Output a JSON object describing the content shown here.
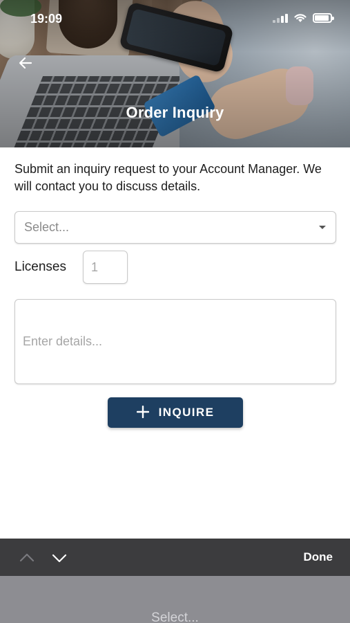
{
  "status_bar": {
    "time": "19:09"
  },
  "header": {
    "title": "Order Inquiry",
    "back_icon": "arrow-left-icon"
  },
  "form": {
    "intro": "Submit an inquiry request to your Account Manager. We will contact you to discuss details.",
    "select": {
      "placeholder": "Select..."
    },
    "licenses": {
      "label": "Licenses",
      "placeholder": "1"
    },
    "details": {
      "placeholder": "Enter details..."
    },
    "submit": {
      "label": "INQUIRE",
      "icon": "plus-icon",
      "color": "#1e3f61"
    }
  },
  "keyboard_toolbar": {
    "prev_icon": "chevron-up-icon",
    "next_icon": "chevron-down-icon",
    "done_label": "Done"
  },
  "picker": {
    "visible_item": "Select..."
  }
}
